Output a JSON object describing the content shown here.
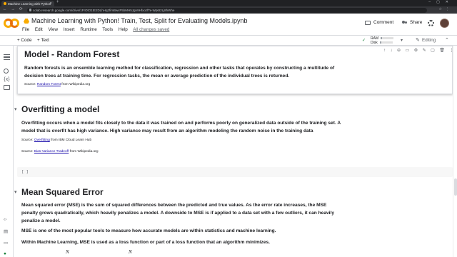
{
  "browser": {
    "tab_title": "Machine Learning with Python",
    "new_tab": "+",
    "url": "colab.research.google.com/drive/1FrOtO1tE2DLhHq2fimBwxF5bMH5Jgn9HfxozfTe-Wp6I2Lj8hWhe"
  },
  "notebook": {
    "title": "Machine Learning with Python! Train, Test, Split for Evaluating Models.ipynb",
    "menu": [
      "File",
      "Edit",
      "View",
      "Insert",
      "Runtime",
      "Tools",
      "Help"
    ],
    "saved_status": "All changes saved",
    "comment_label": "Comment",
    "share_label": "Share"
  },
  "toolbar": {
    "code_label": "+ Code",
    "text_label": "+ Text",
    "ram_label": "RAM",
    "disk_label": "Disk",
    "ram_usage": 0.1,
    "disk_usage": 0.15,
    "editing_label": "Editing"
  },
  "cells": {
    "random_forest": {
      "title": "Model - Random Forest",
      "text": "Random forests is an ensemble learning method for classification, regression and other tasks that operates by constructing a multitude of decision trees at training time. For regression tasks, the mean or average prediction of the individual trees is returned.",
      "source_prefix": "Source: ",
      "source_link": "Random Forest",
      "source_suffix": " from Wikipedia.org"
    },
    "overfitting": {
      "title": "Overfitting a model",
      "text": "Overfitting occurs when a model fits closely to the data it was trained on and performs poorly on generalized data outside of the training set. A model that is overfit has high variance. High variance may result from an algorithm modeling the random noise in the training data",
      "source1_prefix": "Source: ",
      "source1_link": "Overfitting",
      "source1_suffix": " from IBM Cloud Learn Hub",
      "source2_prefix": "Source: ",
      "source2_link": "Bias-Variance Tradeoff",
      "source2_suffix": " from Wikipedia.org"
    },
    "code_cell": {
      "prompt": "[ ]"
    },
    "mse": {
      "title": "Mean Squared Error",
      "text1": "Mean squared error (MSE) is the sum of squared differences between the predicted and true values. As the error rate increases, the MSE penalty grows quadratically, which heavily penalizes a model. A downside to MSE is if applied to a data set with a few outliers, it can heavily penalize a model.",
      "text2": "MSE is one of the most popular tools to measure how accurate models are within statistics and machine learning.",
      "text3": "Within Machine Learning, MSE is used as a loss function or part of a loss function that an algorithm minimizes.",
      "formula_n1": "N",
      "formula_n2": "N"
    }
  }
}
